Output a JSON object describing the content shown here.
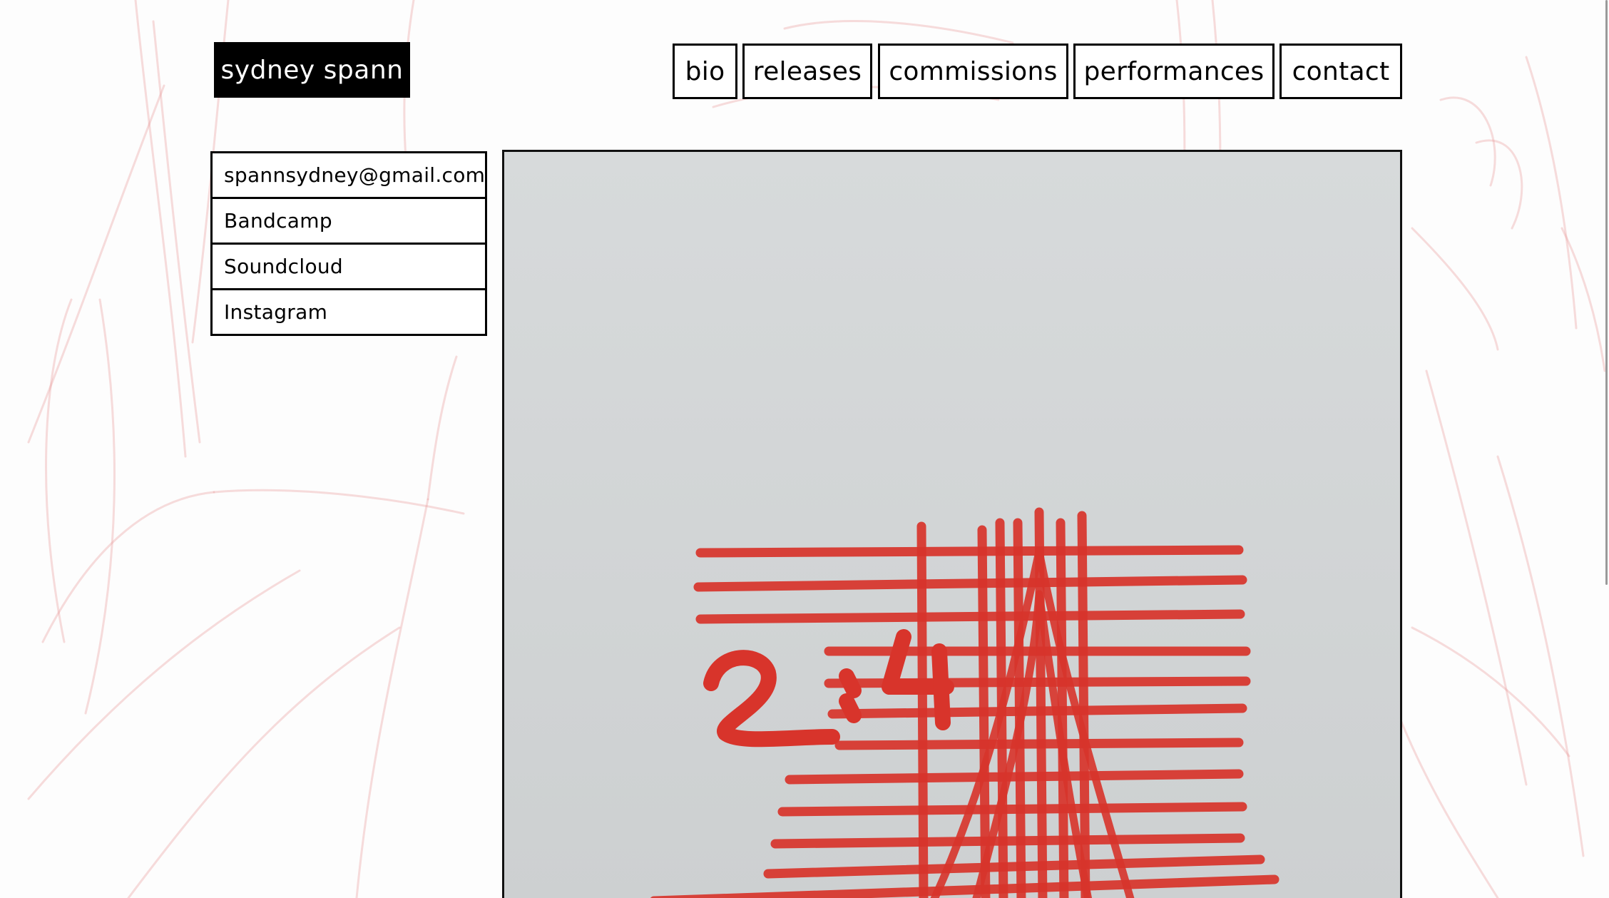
{
  "site": {
    "title": "sydney spann"
  },
  "nav": {
    "items": [
      {
        "label": "bio"
      },
      {
        "label": "releases"
      },
      {
        "label": "commissions"
      },
      {
        "label": "performances"
      },
      {
        "label": "contact"
      }
    ]
  },
  "contact_links": [
    {
      "label": "spannsydney@gmail.com"
    },
    {
      "label": "Bandcamp"
    },
    {
      "label": "Soundcloud"
    },
    {
      "label": "Instagram"
    }
  ],
  "artwork": {
    "scribble_text": "2:4",
    "ink_color": "#d8342b",
    "paper_color": "#d4d7d8"
  },
  "background": {
    "sketch_color": "#e79a9a"
  }
}
